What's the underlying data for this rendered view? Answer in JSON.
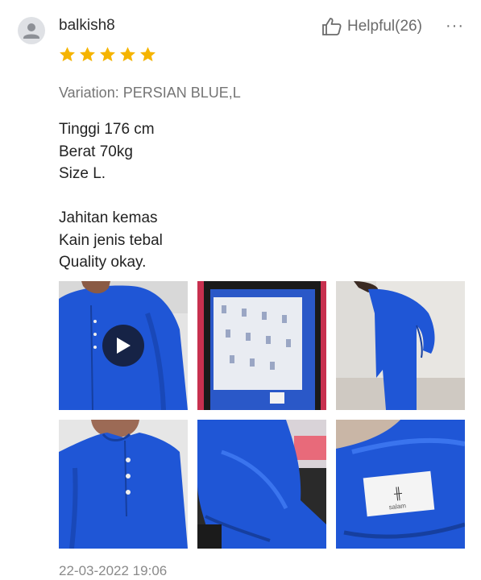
{
  "review": {
    "username": "balkish8",
    "rating": 5,
    "helpful_label": "Helpful(26)",
    "more_label": "···",
    "variation": "Variation: PERSIAN BLUE,L",
    "text_lines": [
      "Tinggi 176 cm",
      "Berat 70kg",
      "Size L."
    ],
    "text_lines_2": [
      "Jahitan kemas",
      "Kain jenis tebal",
      "Quality okay."
    ],
    "timestamp": "22-03-2022 19:06",
    "media_label_text": "salam"
  },
  "icons": {
    "avatar": "user-icon",
    "helpful": "thumbs-up-icon",
    "star": "star-icon",
    "play": "play-icon",
    "more": "ellipsis-icon"
  },
  "colors": {
    "star": "#f5b400",
    "garment_blue": "#1f56d6",
    "muted_text": "#757575"
  }
}
